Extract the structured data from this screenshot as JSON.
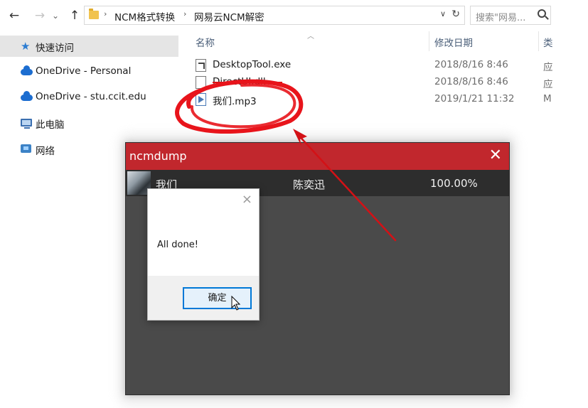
{
  "explorer": {
    "nav": {
      "back_glyph": "←",
      "forward_glyph": "→",
      "recent_glyph": "⌄",
      "up_glyph": "↑"
    },
    "breadcrumb": [
      "NCM格式转换",
      "网易云NCM解密"
    ],
    "breadcrumb_sep": "›",
    "search_placeholder": "搜索\"网易...",
    "sidebar": [
      {
        "label": "快速访问",
        "icon": "star-icon",
        "selected": true
      },
      {
        "label": "OneDrive - Personal",
        "icon": "cloud-icon"
      },
      {
        "label": "OneDrive - stu.ccit.edu",
        "icon": "cloud-icon"
      },
      {
        "label": "此电脑",
        "icon": "computer-icon"
      },
      {
        "label": "网络",
        "icon": "network-icon"
      }
    ],
    "columns": {
      "name": "名称",
      "date": "修改日期",
      "type": "类"
    },
    "files": [
      {
        "name": "DesktopTool.exe",
        "date": "2018/8/16 8:46",
        "type": "应",
        "icon": "exe-icon"
      },
      {
        "name": "DirectUI.dll",
        "date": "2018/8/16 8:46",
        "type": "应",
        "icon": "dll-icon"
      },
      {
        "name": "我们.mp3",
        "date": "2019/1/21 11:32",
        "type": "M",
        "icon": "mp3-icon"
      }
    ]
  },
  "ncmdump": {
    "title": "ncmdump",
    "close_glyph": "✕",
    "row": {
      "song": "我们",
      "artist": "陈奕迅",
      "progress": "100.00%"
    }
  },
  "dialog": {
    "message": "All done!",
    "ok_label": "确定",
    "close_glyph": "×"
  },
  "colors": {
    "ncm_red": "#c1272d",
    "annotation_red": "#e8141b",
    "accent_blue": "#0078d7"
  }
}
